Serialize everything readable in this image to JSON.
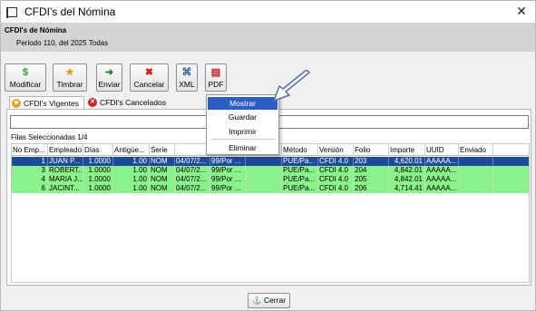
{
  "window": {
    "title": "CFDI's del Nómina",
    "close_glyph": "✕"
  },
  "header": {
    "title": "CFDI's de Nómina",
    "subtitle": "Periodo 110, del 2025 Todas"
  },
  "toolbar": {
    "buttons": [
      {
        "label": "Modificar",
        "icon": "dollar-icon",
        "glyph": "$",
        "color": "#2e9a2e"
      },
      {
        "label": "Timbrar",
        "icon": "stamp-icon",
        "glyph": "★",
        "color": "#d8a020"
      },
      {
        "label": "Enviar",
        "icon": "send-icon",
        "glyph": "➜",
        "color": "#2e7a2e"
      },
      {
        "label": "Cancelar",
        "icon": "cancel-icon",
        "glyph": "✖",
        "color": "#d42020"
      },
      {
        "label": "XML",
        "icon": "xml-icon",
        "glyph": "⌘",
        "color": "#3060a0"
      },
      {
        "label": "PDF",
        "icon": "pdf-icon",
        "glyph": "▤",
        "color": "#c02020"
      }
    ]
  },
  "tabs": [
    {
      "label": "CFDI's Vigentes",
      "icon": "star-icon",
      "active": true,
      "color": "#e0a020"
    },
    {
      "label": "CFDI's Cancelados",
      "icon": "cancel-icon",
      "active": false,
      "color": "#d42020"
    }
  ],
  "grid": {
    "selection_text": "Filas Seleccionadas  1/4",
    "columns": [
      "No Emp...",
      "Empleado",
      "Días",
      "Antigüe...",
      "Serie",
      "",
      "",
      "Condici...",
      "Método",
      "Versión",
      "Folio",
      "Importe",
      "UUID",
      "Enviado"
    ],
    "rows": [
      [
        "1",
        "JUAN P...",
        "1.0000",
        "1.00",
        "NOM",
        "04/07/2...",
        "99/Por ...",
        "",
        "PUE/Pa...",
        "CFDI 4.0",
        "203",
        "4,620.01",
        "AAAAA...",
        ""
      ],
      [
        "3",
        "ROBERT...",
        "1.0000",
        "1.00",
        "NOM",
        "04/07/2...",
        "99/Por ...",
        "",
        "PUE/Pa...",
        "CFDI 4.0",
        "204",
        "4,842.01",
        "AAAAA...",
        ""
      ],
      [
        "4",
        "MARIA J...",
        "1.0000",
        "1.00",
        "NOM",
        "04/07/2...",
        "99/Por ...",
        "",
        "PUE/Pa...",
        "CFDI 4.0",
        "205",
        "4,842.01",
        "AAAAA...",
        ""
      ],
      [
        "6",
        "JACINT...",
        "1.0000",
        "1.00",
        "NOM",
        "04/07/2...",
        "99/Por ...",
        "",
        "PUE/Pa...",
        "CFDI 4.0",
        "206",
        "4,714.41",
        "AAAAA...",
        ""
      ]
    ],
    "colors": {
      "selected_row": "#1e4a9a",
      "row": "#8af28a"
    }
  },
  "pdf_menu": {
    "items": [
      "Mostrar",
      "Guardar",
      "Imprimir",
      "Eliminar"
    ],
    "highlighted": "Mostrar"
  },
  "footer": {
    "close_label": "Cerrar",
    "close_icon": "anchor-icon"
  }
}
